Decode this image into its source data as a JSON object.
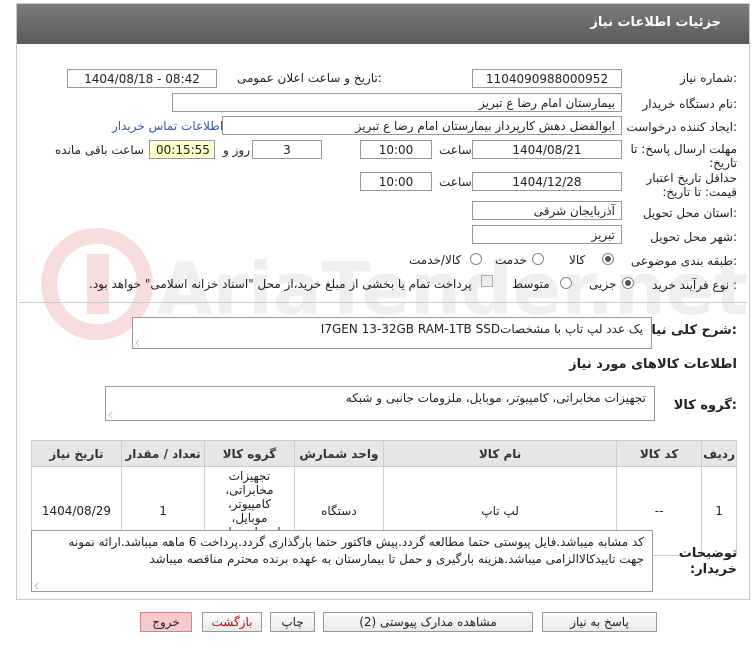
{
  "header": {
    "title": "جزئیات اطلاعات نیاز"
  },
  "labels": {
    "need_number": "شماره نیاز:",
    "announce_datetime": "تاریخ و ساعت اعلان عمومی:",
    "buyer_org": "نام دستگاه خریدار:",
    "requester": "ایجاد کننده درخواست:",
    "contact_link": "اطلاعات تماس خریدار",
    "reply_deadline": "مهلت ارسال پاسخ: تا تاریخ:",
    "time": "ساعت",
    "day_and": "روز و",
    "remaining": "ساعت باقی مانده",
    "price_validity": "حداقل تاریخ اعتبار قیمت: تا تاریخ:",
    "province": "استان محل تحویل:",
    "city": "شهر محل تحویل:",
    "category": "طبقه بندی موضوعی:",
    "process_type": "نوع فرآیند خرید :",
    "general_desc": "شرح کلی نیاز:",
    "goods_info": "اطلاعات کالاهای مورد نیاز",
    "goods_group": "گروه کالا:",
    "buyer_notes": "توضیحات خریدار:"
  },
  "values": {
    "need_number": "1104090988000952",
    "announce_datetime": "1404/08/18 - 08:42",
    "buyer_org": "بیمارستان امام رضا  ع  تبریز",
    "requester": "ابوالفضل دهش کارپرداز بیمارستان امام رضا  ع  تبریز",
    "reply_date": "1404/08/21",
    "reply_time": "10:00",
    "days": "3",
    "remaining_time": "00:15:55",
    "validity_date": "1404/12/28",
    "validity_time": "10:00",
    "province": "آذربایجان شرقی",
    "city": "تبریز",
    "general_desc": "یک عدد لپ تاپ با مشخصاتI7GEN 13-32GB RAM-1TB SSD",
    "goods_group": "تجهیزات مخابراتی، کامپیوتر، موبایل، ملزومات جانبی و شبکه",
    "buyer_notes": "کد مشابه میباشد.فایل پیوستی حتما مطالعه گردد.پیش فاکتور حتما بارگذاری گردد.پرداخت 6 ماهه میباشد.ارائه نمونه جهت تاییدکالاالزامی میباشد.هزینه بارگیری و حمل تا بیمارستان به عهده برنده محترم مناقصه میباشد"
  },
  "category_options": [
    {
      "label": "کالا",
      "selected": true
    },
    {
      "label": "خدمت",
      "selected": false
    },
    {
      "label": "کالا/خدمت",
      "selected": false
    }
  ],
  "process_options": [
    {
      "label": "جزیی",
      "selected": true
    },
    {
      "label": "متوسط",
      "selected": false
    }
  ],
  "payment_note": "پرداخت تمام یا بخشی از مبلغ خرید،از محل \"اسناد خزانه اسلامی\" خواهد بود.",
  "table": {
    "headers": [
      "ردیف",
      "کد کالا",
      "نام کالا",
      "واحد شمارش",
      "گروه کالا",
      "تعداد / مقدار",
      "تاریخ نیاز"
    ],
    "rows": [
      [
        "1",
        "--",
        "لپ تاپ",
        "دستگاه",
        "تجهیزات مخابراتی، کامپیوتر، موبایل، ملزومات جانبی و شبکه",
        "1",
        "1404/08/29"
      ]
    ]
  },
  "buttons": {
    "reply": "پاسخ به نیاز",
    "attachments": "مشاهده مدارک پیوستی (2)",
    "print": "چاپ",
    "back": "بازگشت",
    "exit": "خروج"
  },
  "watermark": "AriaTender.net",
  "colors": {
    "titlebar": "#6a6a6a",
    "link": "#2a5db0",
    "timer_bg": "#ffffcc",
    "exit_bg": "#f6caca"
  }
}
